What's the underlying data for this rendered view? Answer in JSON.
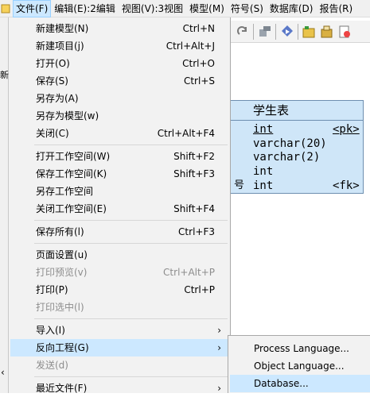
{
  "menubar": {
    "items": [
      "文件(F)",
      "编辑(E):2编辑",
      "视图(V):3视图",
      "模型(M)",
      "符号(S)",
      "数据库(D)",
      "报告(R)"
    ]
  },
  "file_menu": {
    "items": [
      {
        "label": "新建模型(N)",
        "shortcut": "Ctrl+N"
      },
      {
        "label": "新建项目(j)",
        "shortcut": "Ctrl+Alt+J"
      },
      {
        "label": "打开(O)",
        "shortcut": "Ctrl+O"
      },
      {
        "label": "保存(S)",
        "shortcut": "Ctrl+S"
      },
      {
        "label": "另存为(A)",
        "shortcut": ""
      },
      {
        "label": "另存为模型(w)",
        "shortcut": ""
      },
      {
        "label": "关闭(C)",
        "shortcut": "Ctrl+Alt+F4"
      },
      {
        "label": "打开工作空间(W)",
        "shortcut": "Shift+F2"
      },
      {
        "label": "保存工作空间(K)",
        "shortcut": "Shift+F3"
      },
      {
        "label": "另存工作空间",
        "shortcut": ""
      },
      {
        "label": "关闭工作空间(E)",
        "shortcut": "Shift+F4"
      },
      {
        "label": "保存所有(l)",
        "shortcut": "Ctrl+F3"
      },
      {
        "label": "页面设置(u)",
        "shortcut": ""
      },
      {
        "label": "打印预览(v)",
        "shortcut": "Ctrl+Alt+P",
        "disabled": true
      },
      {
        "label": "打印(P)",
        "shortcut": "Ctrl+P"
      },
      {
        "label": "打印选中(l)",
        "shortcut": "",
        "disabled": true
      },
      {
        "label": "导入(I)",
        "shortcut": ""
      },
      {
        "label": "反向工程(G)",
        "shortcut": ""
      },
      {
        "label": "发送(d)",
        "shortcut": "",
        "disabled": true
      },
      {
        "label": "最近文件(F)",
        "shortcut": ""
      }
    ],
    "submenu_arrow": "›"
  },
  "reverse_engineering_submenu": {
    "items": [
      "Process Language...",
      "Object Language...",
      "Database..."
    ]
  },
  "entity": {
    "title": "学生表",
    "attributes": [
      {
        "type": "int",
        "key": "<pk>",
        "prefix": ""
      },
      {
        "type": "varchar(20)",
        "key": "",
        "prefix": ""
      },
      {
        "type": "varchar(2)",
        "key": "",
        "prefix": ""
      },
      {
        "type": "int",
        "key": "",
        "prefix": ""
      },
      {
        "type": "int",
        "key": "<fk>",
        "prefix": "号"
      }
    ]
  },
  "left_strip": {
    "glyph_top": "新",
    "glyph_bottom": "‹"
  },
  "colors": {
    "highlight": "#cce8ff",
    "entity_fill": "#cfe6f8",
    "entity_border": "#6e8fb0",
    "menu_bg": "#f2f2f2",
    "disabled_text": "#8d8d8d"
  },
  "icons": {
    "toolbar": [
      "redo-icon",
      "format-painter-icon",
      "open-object-icon",
      "new-folder-icon",
      "package-icon",
      "report-icon"
    ]
  }
}
